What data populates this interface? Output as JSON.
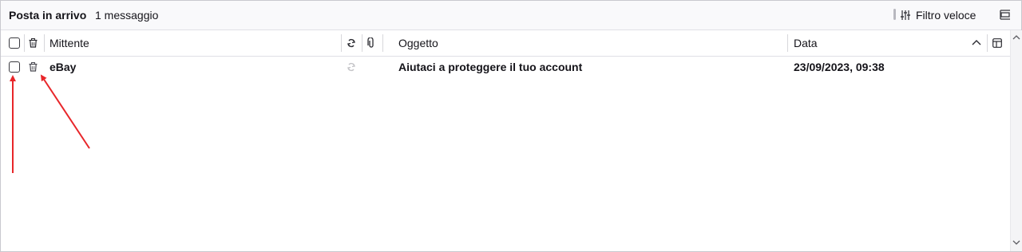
{
  "header": {
    "folder_name": "Posta in arrivo",
    "message_count": "1 messaggio",
    "quick_filter_label": "Filtro veloce"
  },
  "columns": {
    "sender": "Mittente",
    "subject": "Oggetto",
    "date": "Data"
  },
  "messages": [
    {
      "sender": "eBay",
      "subject": "Aiutaci a proteggere il tuo account",
      "date": "23/09/2023, 09:38",
      "unread": true
    }
  ],
  "icons": {
    "select_all": "checkbox-icon",
    "delete_column": "trash-icon",
    "thread_column": "thread-icon",
    "attachment_column": "paperclip-icon",
    "sort_direction": "chevron-up-icon",
    "column_picker": "column-picker-icon",
    "quick_filter": "sliders-icon",
    "layout": "layout-icon"
  },
  "colors": {
    "annotation_arrow": "#e8262a"
  }
}
